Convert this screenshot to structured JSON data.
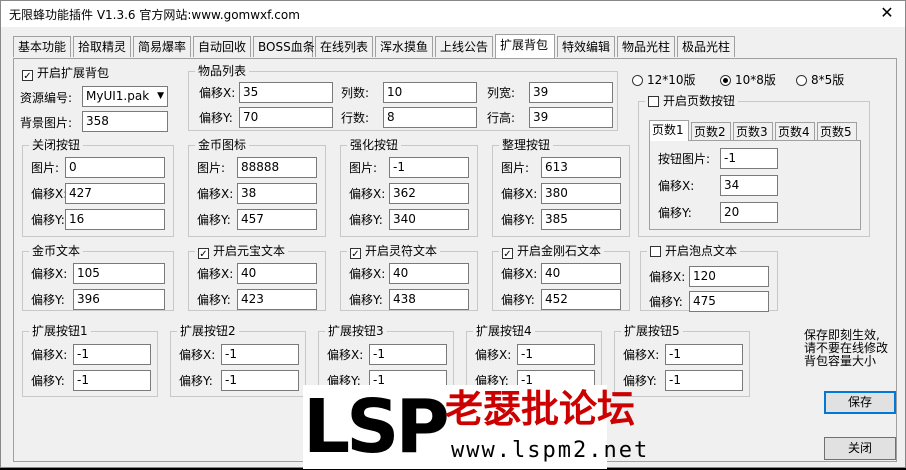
{
  "window": {
    "title": "无限蜂功能插件 V1.3.6  官方网站:www.gomwxf.com",
    "close": "✕"
  },
  "tabs": [
    "基本功能",
    "拾取精灵",
    "简易爆率",
    "自动回收",
    "BOSS血条",
    "在线列表",
    "浑水摸鱼",
    "上线公告",
    "扩展背包",
    "特效编辑",
    "物品光柱",
    "极品光柱"
  ],
  "enable_bag": {
    "label": "开启扩展背包",
    "checked": true
  },
  "resource": {
    "label": "资源编号:",
    "value": "MyUI1.pak"
  },
  "bg_image": {
    "label": "背景图片:",
    "value": "358"
  },
  "item_list": {
    "title": "物品列表",
    "offx_label": "偏移X:",
    "offx": "35",
    "cols_label": "列数:",
    "cols": "10",
    "colw_label": "列宽:",
    "colw": "39",
    "offy_label": "偏移Y:",
    "offy": "70",
    "rows_label": "行数:",
    "rows": "8",
    "rowh_label": "行高:",
    "rowh": "39"
  },
  "version_radios": {
    "r1": "12*10版",
    "r2": "10*8版",
    "r3": "8*5版",
    "selected": "r2"
  },
  "page_buttons": {
    "enable_label": "开启页数按钮",
    "checked": false,
    "tabs": [
      "页数1",
      "页数2",
      "页数3",
      "页数4",
      "页数5"
    ],
    "img_label": "按钮图片:",
    "img": "-1",
    "offx_label": "偏移X:",
    "offx": "34",
    "offy_label": "偏移Y:",
    "offy": "20"
  },
  "close_btn": {
    "title": "关闭按钮",
    "img_label": "图片:",
    "img": "0",
    "offx_label": "偏移X:",
    "offx": "427",
    "offy_label": "偏移Y:",
    "offy": "16"
  },
  "gold_icon": {
    "title": "金币图标",
    "img_label": "图片:",
    "img": "88888",
    "offx_label": "偏移X:",
    "offx": "38",
    "offy_label": "偏移Y:",
    "offy": "457"
  },
  "enhance_btn": {
    "title": "强化按钮",
    "img_label": "图片:",
    "img": "-1",
    "offx_label": "偏移X:",
    "offx": "362",
    "offy_label": "偏移Y:",
    "offy": "340"
  },
  "sort_btn": {
    "title": "整理按钮",
    "img_label": "图片:",
    "img": "613",
    "offx_label": "偏移X:",
    "offx": "380",
    "offy_label": "偏移Y:",
    "offy": "385"
  },
  "gold_text": {
    "title": "金币文本",
    "offx_label": "偏移X:",
    "offx": "105",
    "offy_label": "偏移Y:",
    "offy": "396"
  },
  "yuanbao_text": {
    "title": "开启元宝文本",
    "checked": true,
    "offx_label": "偏移X:",
    "offx": "40",
    "offy_label": "偏移Y:",
    "offy": "423"
  },
  "lingfu_text": {
    "title": "开启灵符文本",
    "checked": true,
    "offx_label": "偏移X:",
    "offx": "40",
    "offy_label": "偏移Y:",
    "offy": "438"
  },
  "diamond_text": {
    "title": "开启金刚石文本",
    "checked": true,
    "offx_label": "偏移X:",
    "offx": "40",
    "offy_label": "偏移Y:",
    "offy": "452"
  },
  "bubble_text": {
    "title": "开启泡点文本",
    "checked": false,
    "offx_label": "偏移X:",
    "offx": "120",
    "offy_label": "偏移Y:",
    "offy": "475"
  },
  "ext_buttons": [
    {
      "title": "扩展按钮1",
      "offx_label": "偏移X:",
      "offx": "-1",
      "offy_label": "偏移Y:",
      "offy": "-1"
    },
    {
      "title": "扩展按钮2",
      "offx_label": "偏移X:",
      "offx": "-1",
      "offy_label": "偏移Y:",
      "offy": "-1"
    },
    {
      "title": "扩展按钮3",
      "offx_label": "偏移X:",
      "offx": "-1",
      "offy_label": "偏移Y:",
      "offy": "-1"
    },
    {
      "title": "扩展按钮4",
      "offx_label": "偏移X:",
      "offx": "-1",
      "offy_label": "偏移Y:",
      "offy": "-1"
    },
    {
      "title": "扩展按钮5",
      "offx_label": "偏移X:",
      "offx": "-1",
      "offy_label": "偏移Y:",
      "offy": "-1"
    }
  ],
  "notice": "保存即刻生效,\n请不要在线修改\n背包容量大小",
  "save_label": "保存",
  "close_label": "关闭",
  "watermark": {
    "big": "LSP",
    "cn": "老瑟批论坛",
    "url": "www.lspm2.net"
  }
}
